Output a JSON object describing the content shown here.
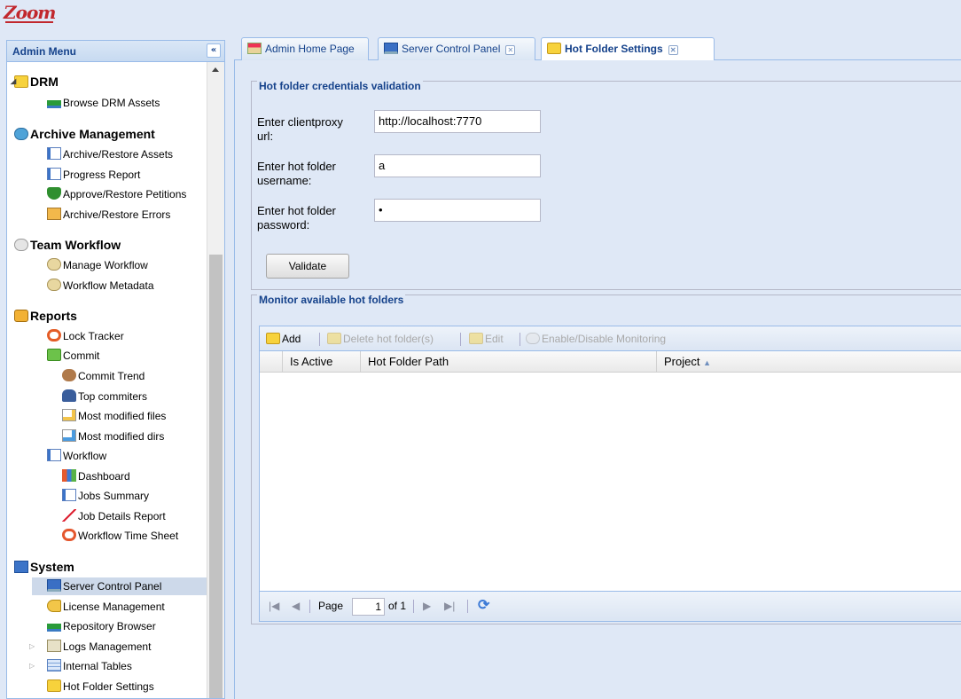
{
  "app": {
    "logo": "Zoom"
  },
  "sidebar": {
    "title": "Admin Menu",
    "collapse_icon": "«",
    "items": [
      {
        "label": "DRM",
        "type": "category",
        "icon": "folder-icon"
      },
      {
        "label": "Browse DRM Assets",
        "icon": "network-icon"
      },
      {
        "label": "Archive Management",
        "type": "category",
        "icon": "archive-icon"
      },
      {
        "label": "Archive/Restore Assets",
        "icon": "archive-doc-icon"
      },
      {
        "label": "Progress Report",
        "icon": "document-icon"
      },
      {
        "label": "Approve/Restore Petitions",
        "icon": "shield-icon"
      },
      {
        "label": "Archive/Restore Errors",
        "icon": "warning-icon"
      },
      {
        "label": "Team Workflow",
        "type": "category",
        "icon": "gears-icon"
      },
      {
        "label": "Manage Workflow",
        "icon": "gear-icon"
      },
      {
        "label": "Workflow Metadata",
        "icon": "gear-icon"
      },
      {
        "label": "Reports",
        "type": "category",
        "icon": "report-icon"
      },
      {
        "label": "Lock Tracker",
        "icon": "lock-icon"
      },
      {
        "label": "Commit",
        "icon": "commit-icon"
      },
      {
        "label": "Commit Trend",
        "icon": "people-icon"
      },
      {
        "label": "Top commiters",
        "icon": "person-icon"
      },
      {
        "label": "Most modified files",
        "icon": "file-icon"
      },
      {
        "label": "Most modified dirs",
        "icon": "dir-icon"
      },
      {
        "label": "Workflow",
        "icon": "document-icon"
      },
      {
        "label": "Dashboard",
        "icon": "bar-chart-icon"
      },
      {
        "label": "Jobs Summary",
        "icon": "document-icon"
      },
      {
        "label": "Job Details Report",
        "icon": "line-chart-icon"
      },
      {
        "label": "Workflow Time Sheet",
        "icon": "clock-icon"
      },
      {
        "label": "System",
        "type": "category",
        "icon": "system-icon"
      },
      {
        "label": "Server Control Panel",
        "icon": "monitor-icon",
        "selected": true
      },
      {
        "label": "License Management",
        "icon": "key-icon"
      },
      {
        "label": "Repository Browser",
        "icon": "network-icon"
      },
      {
        "label": "Logs Management",
        "icon": "logs-icon"
      },
      {
        "label": "Internal Tables",
        "icon": "table-icon"
      },
      {
        "label": "Hot Folder Settings",
        "icon": "folder-icon"
      }
    ]
  },
  "tabs": [
    {
      "label": "Admin Home Page",
      "icon": "home-icon"
    },
    {
      "label": "Server Control Panel",
      "icon": "monitor-icon",
      "closable": true
    },
    {
      "label": "Hot Folder Settings",
      "icon": "folder-icon",
      "closable": true,
      "active": true
    }
  ],
  "credentials": {
    "legend": "Hot folder credentials validation",
    "clientproxy_label": "Enter clientproxy url:",
    "clientproxy_value": "http://localhost:7770",
    "username_label": "Enter hot folder username:",
    "username_value": "a",
    "password_label": "Enter hot folder password:",
    "password_value": "•",
    "validate_button": "Validate"
  },
  "monitor": {
    "legend": "Monitor available hot folders",
    "toolbar": {
      "add": "Add",
      "delete": "Delete hot folder(s)",
      "edit": "Edit",
      "toggle": "Enable/Disable Monitoring"
    },
    "columns": [
      "Is Active",
      "Hot Folder Path",
      "Project"
    ],
    "sort_indicator": "▲",
    "pager": {
      "page_label": "Page",
      "page_value": "1",
      "of_label": "of 1"
    }
  },
  "colors": {
    "accent": "#15428b",
    "border": "#99bbe8",
    "logo": "#c1272d"
  }
}
